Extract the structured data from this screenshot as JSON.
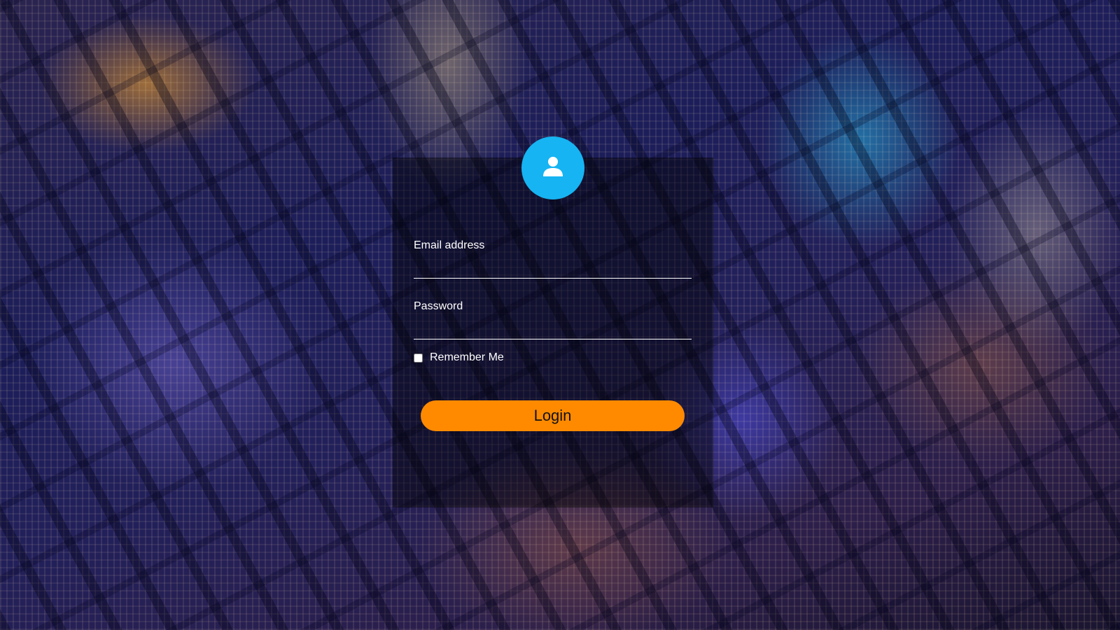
{
  "background": {
    "description_icon": "city-night-aerial"
  },
  "login": {
    "avatar_icon": "user-icon",
    "avatar_color": "#16b4f2",
    "email_label": "Email address",
    "email_value": "",
    "password_label": "Password",
    "password_value": "",
    "remember_label": "Remember Me",
    "remember_checked": false,
    "button_label": "Login",
    "button_color": "#ff8a00"
  }
}
